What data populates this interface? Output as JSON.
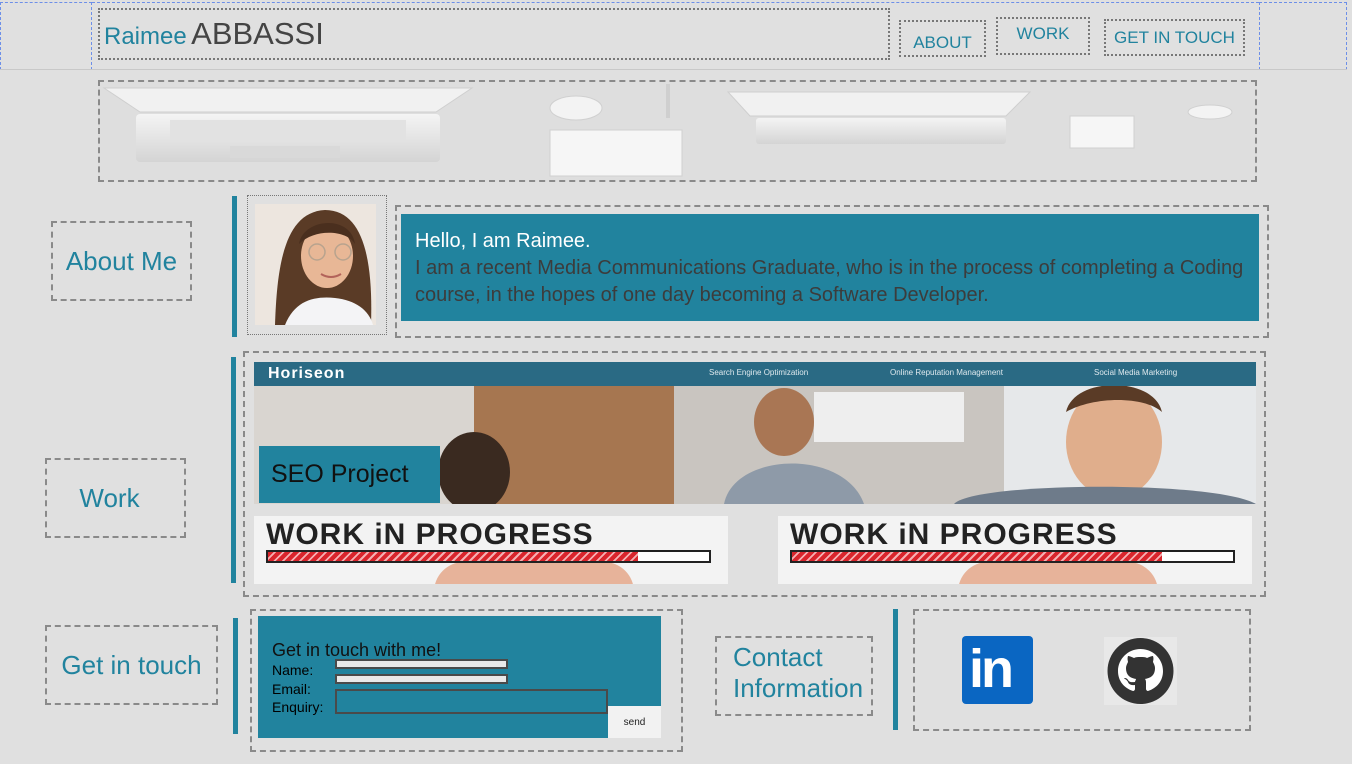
{
  "header": {
    "first_name": "Raimee",
    "last_name": "ABBASSI",
    "nav": [
      {
        "label": "ABOUT"
      },
      {
        "label": "WORK"
      },
      {
        "label": "GET IN TOUCH"
      }
    ]
  },
  "sections": {
    "about": "About Me",
    "work": "Work",
    "contact": "Get in touch"
  },
  "about": {
    "greeting": "Hello, I am Raimee.",
    "description": "I am a recent Media Communications Graduate, who is in the process of completing a Coding course, in the hopes of one day becoming a Software Developer."
  },
  "work": {
    "seo_site": {
      "brand": "Horiseon",
      "links": [
        "Search Engine Optimization",
        "Online Reputation Management",
        "Social Media Marketing"
      ]
    },
    "seo_label": "SEO Project",
    "placeholders": [
      {
        "text": "WORK iN PROGRESS"
      },
      {
        "text": "WORK iN PROGRESS"
      }
    ]
  },
  "contact_form": {
    "title": "Get in touch with me!",
    "name_label": "Name:",
    "email_label": "Email:",
    "enquiry_label": "Enquiry:",
    "send_label": "send"
  },
  "contact_info": {
    "label": "Contact Information",
    "linkedin_text": "in"
  },
  "colors": {
    "accent": "#21839e",
    "background": "#e0e0e0",
    "linkedin": "#0a66c2",
    "github": "#333333"
  },
  "icons": [
    "linkedin-icon",
    "github-icon"
  ]
}
